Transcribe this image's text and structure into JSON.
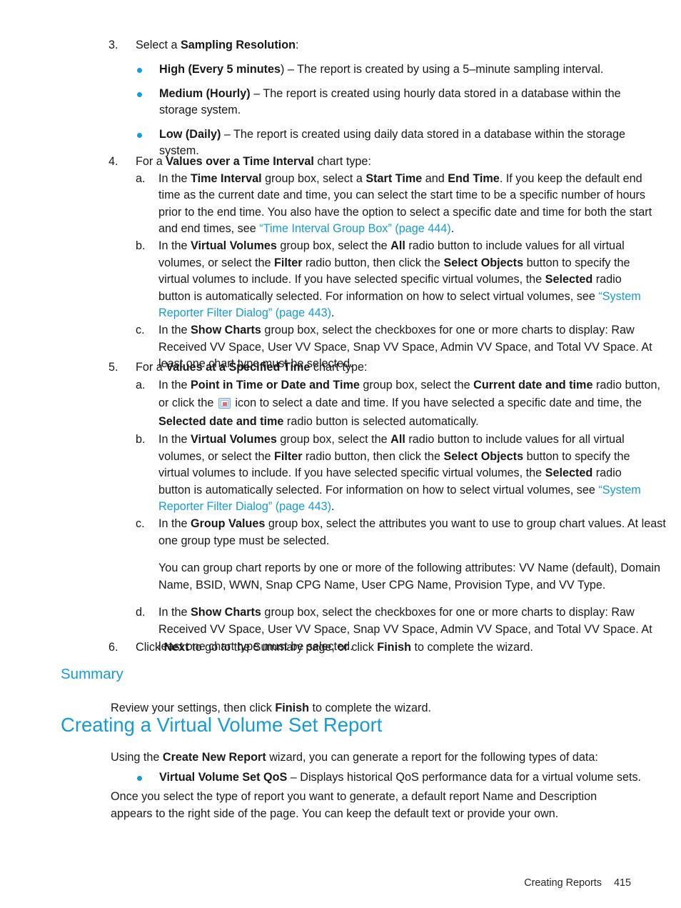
{
  "page": {
    "number": "415",
    "footer_section": "Creating Reports"
  },
  "colors": {
    "heading": "#159BD7",
    "link": "#159BD7",
    "bullet": "#159BD7",
    "text": "#181818"
  },
  "steps": [
    {
      "marker": "3.",
      "lead_plain_1": "Select a ",
      "lead_bold": "Sampling Resolution",
      "lead_plain_2": ":",
      "bullets": [
        {
          "bold": "High (Every 5 minutes",
          "rest": ") – The report is created by using a 5–minute sampling interval."
        },
        {
          "bold": "Medium (Hourly)",
          "rest": " – The report is created using hourly data stored in a database within the storage system."
        },
        {
          "bold": "Low (Daily)",
          "rest": " – The report is created using daily data stored in a database within the storage system."
        }
      ]
    },
    {
      "marker": "4.",
      "lead_plain_1": "For a ",
      "lead_bold": "Values over a Time Interval",
      "lead_plain_2": " chart type:",
      "subitems": [
        {
          "marker": "a.",
          "segments": [
            {
              "t": "In the ",
              "s": "plain"
            },
            {
              "t": "Time Interval",
              "s": "bold"
            },
            {
              "t": " group box, select a ",
              "s": "plain"
            },
            {
              "t": "Start Time",
              "s": "bold"
            },
            {
              "t": " and ",
              "s": "plain"
            },
            {
              "t": "End Time",
              "s": "bold"
            },
            {
              "t": ". If you keep the default end time as the current date and time, you can select the start time to be a specific number of hours prior to the end time. You also have the option to select a specific date and time for both the start and end times, see ",
              "s": "plain"
            },
            {
              "t": "“Time Interval Group Box” (page 444)",
              "s": "link"
            },
            {
              "t": ".",
              "s": "plain"
            }
          ]
        },
        {
          "marker": "b.",
          "segments": [
            {
              "t": "In the ",
              "s": "plain"
            },
            {
              "t": "Virtual Volumes",
              "s": "bold"
            },
            {
              "t": " group box, select the ",
              "s": "plain"
            },
            {
              "t": "All",
              "s": "bold"
            },
            {
              "t": " radio button to include values for all virtual volumes, or select the ",
              "s": "plain"
            },
            {
              "t": "Filter",
              "s": "bold"
            },
            {
              "t": " radio button, then click the ",
              "s": "plain"
            },
            {
              "t": "Select Objects",
              "s": "bold"
            },
            {
              "t": "  button to specify the virtual volumes to include. If you have selected specific virtual volumes, the ",
              "s": "plain"
            },
            {
              "t": "Selected",
              "s": "bold"
            },
            {
              "t": " radio button is automatically selected. For information on how to select virtual volumes, see ",
              "s": "plain"
            },
            {
              "t": "“System Reporter Filter Dialog” (page 443)",
              "s": "link"
            },
            {
              "t": ".",
              "s": "plain"
            }
          ]
        },
        {
          "marker": "c.",
          "segments": [
            {
              "t": "In the ",
              "s": "plain"
            },
            {
              "t": "Show Charts",
              "s": "bold"
            },
            {
              "t": " group box, select the checkboxes for one or more charts to display: Raw Received VV Space, User VV Space, Snap VV Space, Admin VV Space, and Total VV Space. At least one chart type must be selected.",
              "s": "plain"
            }
          ]
        }
      ]
    },
    {
      "marker": "5.",
      "lead_plain_1": "For a ",
      "lead_bold": "Values at a Specified Time",
      "lead_plain_2": " chart type:",
      "subitems": [
        {
          "marker": "a.",
          "segments": [
            {
              "t": "In the ",
              "s": "plain"
            },
            {
              "t": "Point in Time or Date and Time",
              "s": "bold"
            },
            {
              "t": " group box, select the ",
              "s": "plain"
            },
            {
              "t": "Current date and time",
              "s": "bold"
            },
            {
              "t": " radio button, or click the ",
              "s": "plain"
            },
            {
              "t": "",
              "s": "icon",
              "icon": "calendar-date-picker-icon"
            },
            {
              "t": " icon to select a date and time. If you have selected a specific date and time, the ",
              "s": "plain"
            },
            {
              "t": "Selected date and time",
              "s": "bold"
            },
            {
              "t": " radio button is selected automatically.",
              "s": "plain"
            }
          ]
        },
        {
          "marker": "b.",
          "segments": [
            {
              "t": "In the ",
              "s": "plain"
            },
            {
              "t": "Virtual Volumes",
              "s": "bold"
            },
            {
              "t": " group box, select the ",
              "s": "plain"
            },
            {
              "t": "All",
              "s": "bold"
            },
            {
              "t": " radio button to include values for all virtual volumes, or select the ",
              "s": "plain"
            },
            {
              "t": "Filter",
              "s": "bold"
            },
            {
              "t": " radio button, then click the ",
              "s": "plain"
            },
            {
              "t": "Select Objects",
              "s": "bold"
            },
            {
              "t": "  button to specify the virtual volumes to include. If you have selected specific virtual volumes, the ",
              "s": "plain"
            },
            {
              "t": "Selected",
              "s": "bold"
            },
            {
              "t": " radio button is automatically selected. For information on how to select virtual volumes, see ",
              "s": "plain"
            },
            {
              "t": "“System Reporter Filter Dialog” (page 443)",
              "s": "link"
            },
            {
              "t": ".",
              "s": "plain"
            }
          ]
        },
        {
          "marker": "c.",
          "segments": [
            {
              "t": "In the ",
              "s": "plain"
            },
            {
              "t": "Group Values",
              "s": "bold"
            },
            {
              "t": " group box, select the attributes you want to use to group chart values. At least one group type must be selected.",
              "s": "plain"
            }
          ],
          "extra_paragraph": "You can group chart reports by one or more of the following attributes: VV Name (default), Domain Name, BSID, WWN, Snap CPG Name, User CPG Name, Provision Type, and VV Type."
        },
        {
          "marker": "d.",
          "segments": [
            {
              "t": "In the ",
              "s": "plain"
            },
            {
              "t": "Show Charts",
              "s": "bold"
            },
            {
              "t": " group box, select the checkboxes for one or more charts to display: Raw Received VV Space, User VV Space, Snap VV Space, Admin VV Space, and Total VV Space. At least one chart type must be selected.",
              "s": "plain"
            }
          ]
        }
      ]
    },
    {
      "marker": "6.",
      "segments": [
        {
          "t": "Click ",
          "s": "plain"
        },
        {
          "t": "Next",
          "s": "bold"
        },
        {
          "t": " to go to the Summary page, or click ",
          "s": "plain"
        },
        {
          "t": "Finish",
          "s": "bold"
        },
        {
          "t": " to complete the wizard.",
          "s": "plain"
        }
      ]
    }
  ],
  "summary_section": {
    "heading": "Summary",
    "paragraph": [
      {
        "t": "Review your settings, then click ",
        "s": "plain"
      },
      {
        "t": "Finish",
        "s": "bold"
      },
      {
        "t": " to complete the wizard.",
        "s": "plain"
      }
    ]
  },
  "vvset_section": {
    "heading": "Creating a Virtual Volume Set Report",
    "intro": [
      {
        "t": "Using the ",
        "s": "plain"
      },
      {
        "t": "Create New Report",
        "s": "bold"
      },
      {
        "t": " wizard, you can generate a report for the following types of data:",
        "s": "plain"
      }
    ],
    "bullet": {
      "bold": "Virtual Volume Set QoS",
      "rest": " – Displays historical QoS performance data for a virtual volume sets."
    },
    "closing": "Once you select the type of report you want to generate, a default report Name and Description appears to the right side of the page. You can keep the default text or provide your own."
  }
}
